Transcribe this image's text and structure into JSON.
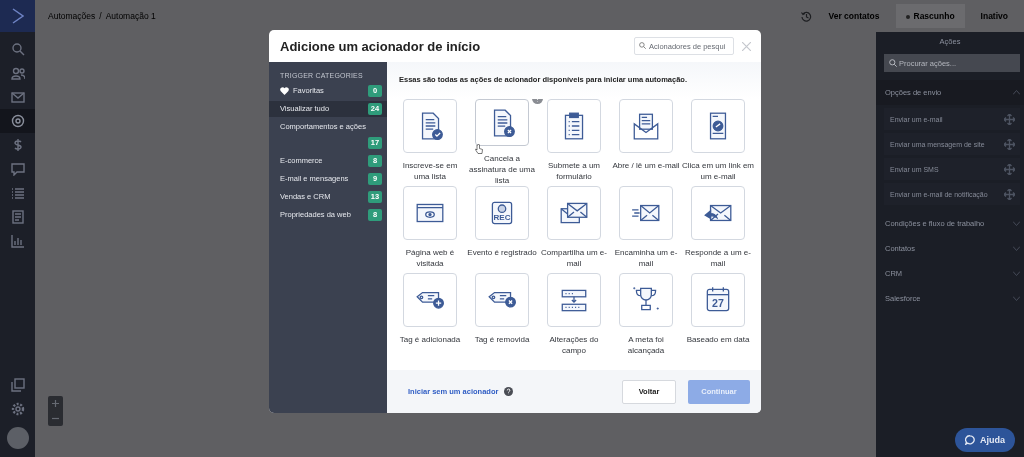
{
  "nav": {
    "items": [
      {
        "kind": "search",
        "selected": false
      },
      {
        "kind": "contacts",
        "selected": false
      },
      {
        "kind": "mail",
        "selected": false
      },
      {
        "kind": "automations",
        "selected": true
      },
      {
        "kind": "deals",
        "selected": false
      },
      {
        "kind": "chat",
        "selected": false
      },
      {
        "kind": "lists",
        "selected": false
      },
      {
        "kind": "pages",
        "selected": false
      },
      {
        "kind": "reports",
        "selected": false
      }
    ],
    "bottom_items": [
      {
        "kind": "copy",
        "selected": false
      },
      {
        "kind": "settings",
        "selected": false
      }
    ]
  },
  "topbar": {
    "breadcrumb": [
      "Automações",
      "Automação 1"
    ],
    "separator": "/",
    "buttons": [
      {
        "label": "Ver contatos",
        "kind": "link"
      },
      {
        "label": "Rascunho",
        "kind": "status",
        "selected": true
      },
      {
        "label": "Inativo",
        "kind": "status",
        "selected": false
      }
    ]
  },
  "actions_panel": {
    "title": "Ações",
    "search": {
      "placeholder": "Procurar ações..."
    },
    "sections": [
      {
        "title": "Opções de envio",
        "expanded": true,
        "items": [
          "Enviar um e-mail",
          "Enviar uma mensagem de site",
          "Enviar um SMS",
          "Enviar um e-mail de notificação"
        ]
      },
      {
        "title": "Condições e fluxo de trabalho",
        "expanded": false
      },
      {
        "title": "Contatos",
        "expanded": false
      },
      {
        "title": "CRM",
        "expanded": false
      },
      {
        "title": "Salesforce",
        "expanded": false
      }
    ]
  },
  "modal": {
    "title": "Adicione um acionador de início",
    "search": {
      "placeholder": "Acionadores de pesqui"
    },
    "categories_heading": "TRIGGER CATEGORIES",
    "categories": [
      {
        "label": "Favoritas",
        "count": "0",
        "kind": "favorites",
        "selected": false
      },
      {
        "label": "Visualizar tudo",
        "count": "24",
        "kind": "plain",
        "selected": true
      },
      {
        "label": "Comportamentos e ações",
        "count": "17",
        "kind": "plain",
        "selected": false
      },
      {
        "label": "E-commerce",
        "count": "8",
        "kind": "plain",
        "selected": false
      },
      {
        "label": "E-mail e mensagens",
        "count": "9",
        "kind": "plain",
        "selected": false
      },
      {
        "label": "Vendas e CRM",
        "count": "13",
        "kind": "plain",
        "selected": false
      },
      {
        "label": "Propriedades da web",
        "count": "8",
        "kind": "plain",
        "selected": false
      }
    ],
    "intro": "Essas são todas as ações de acionador disponíveis para iniciar uma automação.",
    "triggers": [
      {
        "label": "Inscreve-se em uma lista",
        "kind": "subscribe",
        "hovered": false
      },
      {
        "label": "Cancela a assinatura de uma lista",
        "kind": "unsubscribe",
        "hovered": true
      },
      {
        "label": "Submete a um formulário",
        "kind": "form",
        "hovered": false
      },
      {
        "label": "Abre / lê um e-mail",
        "kind": "open",
        "hovered": false
      },
      {
        "label": "Clica em um link em um e-mail",
        "kind": "click",
        "hovered": false
      },
      {
        "label": "Página web é visitada",
        "kind": "webpage",
        "hovered": false
      },
      {
        "label": "Evento é registrado",
        "kind": "event",
        "icon_text": "REC",
        "hovered": false
      },
      {
        "label": "Compartilha um e-mail",
        "kind": "share",
        "hovered": false
      },
      {
        "label": "Encaminha um e-mail",
        "kind": "forward",
        "hovered": false
      },
      {
        "label": "Responde a um e-mail",
        "kind": "reply",
        "hovered": false
      },
      {
        "label": "Tag é adicionada",
        "kind": "tagadd",
        "hovered": false
      },
      {
        "label": "Tag é removida",
        "kind": "tagremove",
        "hovered": false
      },
      {
        "label": "Alterações do campo",
        "kind": "field",
        "hovered": false
      },
      {
        "label": "A meta foi alcançada",
        "kind": "goal",
        "hovered": false
      },
      {
        "label": "Baseado em data",
        "kind": "date",
        "icon_text": "27",
        "hovered": false
      }
    ],
    "footer": {
      "link": "Iniciar sem um acionador",
      "back": "Voltar",
      "continue": {
        "label": "Continuar",
        "disabled": true
      }
    }
  },
  "help_button": {
    "label": "Ajuda"
  }
}
